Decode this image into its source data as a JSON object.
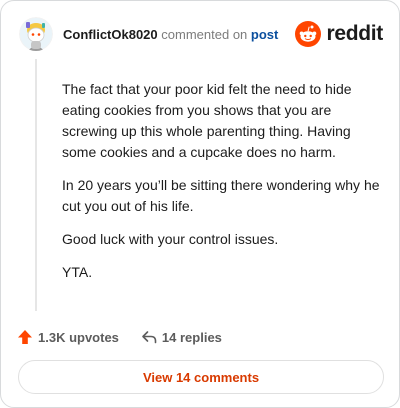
{
  "header": {
    "username": "ConflictOk8020",
    "commented_on": "commented on",
    "post_link": "post",
    "brand": "reddit"
  },
  "comment": {
    "paragraphs": [
      "The fact that your poor kid felt the need to hide eating cookies from you shows that you are screwing up this whole parenting thing. Having some cookies and a cupcake does no harm.",
      "In 20 years you’ll be sitting there wondering why he cut you out of his life.",
      "Good luck with your control issues.",
      "YTA."
    ]
  },
  "actions": {
    "upvotes": "1.3K upvotes",
    "replies": "14 replies"
  },
  "footer": {
    "view_comments": "View 14 comments"
  },
  "colors": {
    "reddit_orange": "#ff4500",
    "link_blue": "#0b4f9e",
    "view_button_text": "#d93a00",
    "upvote_arrow": "#ff4500"
  }
}
